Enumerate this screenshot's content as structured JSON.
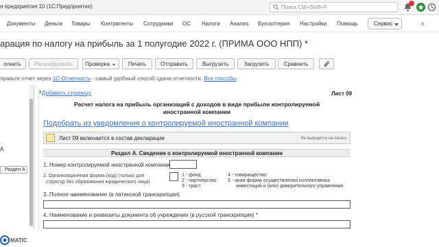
{
  "titlebar": {
    "app_title": "я предприятия 10  (1С:Предприятие)",
    "search_placeholder": "Поиск Ctrl+Shift+F"
  },
  "menu": {
    "items": [
      "Документы",
      "Деньги",
      "Товары",
      "Контрагенты",
      "Сотрудники",
      "ОС",
      "Налоги",
      "Анализ",
      "Бухгалтерия",
      "Настройки",
      "Помощь"
    ],
    "service_label": "Сервис",
    "close_glyph": "×"
  },
  "document": {
    "title": "арация по налогу на прибыль за 1 полугодие 2022 г. (ПРИМА ООО НПП) *"
  },
  "toolbar": {
    "fill": "олнить",
    "decipher": "Расшифровать",
    "check": "Проверка",
    "print": "Печать",
    "send": "Отправить",
    "upload": "Выгрузить",
    "load": "Загрузить",
    "compare": "Сравнить"
  },
  "infobar": {
    "text_before": "правьте отчет через ",
    "link1": "1С-Отчетность",
    "text_mid": " - самый удобный способ сдачи отчетности. ",
    "link2": "Все способы"
  },
  "left_panel": {
    "label_a": "А",
    "label_razdel": ". Раздел А"
  },
  "form": {
    "add_page": "Добавить страницу",
    "sheet": "Лист 09",
    "calc_title_line1": "Расчет налога на прибыль организаций с доходов в виде прибыли контролируемой",
    "calc_title_line2": "иностранной компании",
    "pick_link": "Подобрать из уведомления о контролируемой иностранной компании",
    "include_label": "Лист 09 включается в состав декларации",
    "not_printed": "Не выводится на печать",
    "section_a": "Раздел А. Сведения о контролируемой иностранной компании",
    "field1": "1. Номер контролируемой иностранной компании",
    "field2_line1": "2. Организационная форма (код) (только для",
    "field2_line2": "структур без образования юридического лица)",
    "legend": [
      "1 - фонд",
      "2 - партнерство",
      "3 - траст",
      "4 - товарищество",
      "5 - иная форма осуществления коллективных",
      "инвестиций и (или) доверительного управления"
    ],
    "field3": "3. Полное наименование (в латинской транскрипции)",
    "field4": "4. Наименование и реквизиты документа об учреждении (в русской транскрипции) *"
  },
  "footer": {
    "brand": "MATIC"
  },
  "colors": {
    "link": "#3b6ec7",
    "checkbox_fill": "#f3e9a8",
    "badge": "#dd3333"
  }
}
